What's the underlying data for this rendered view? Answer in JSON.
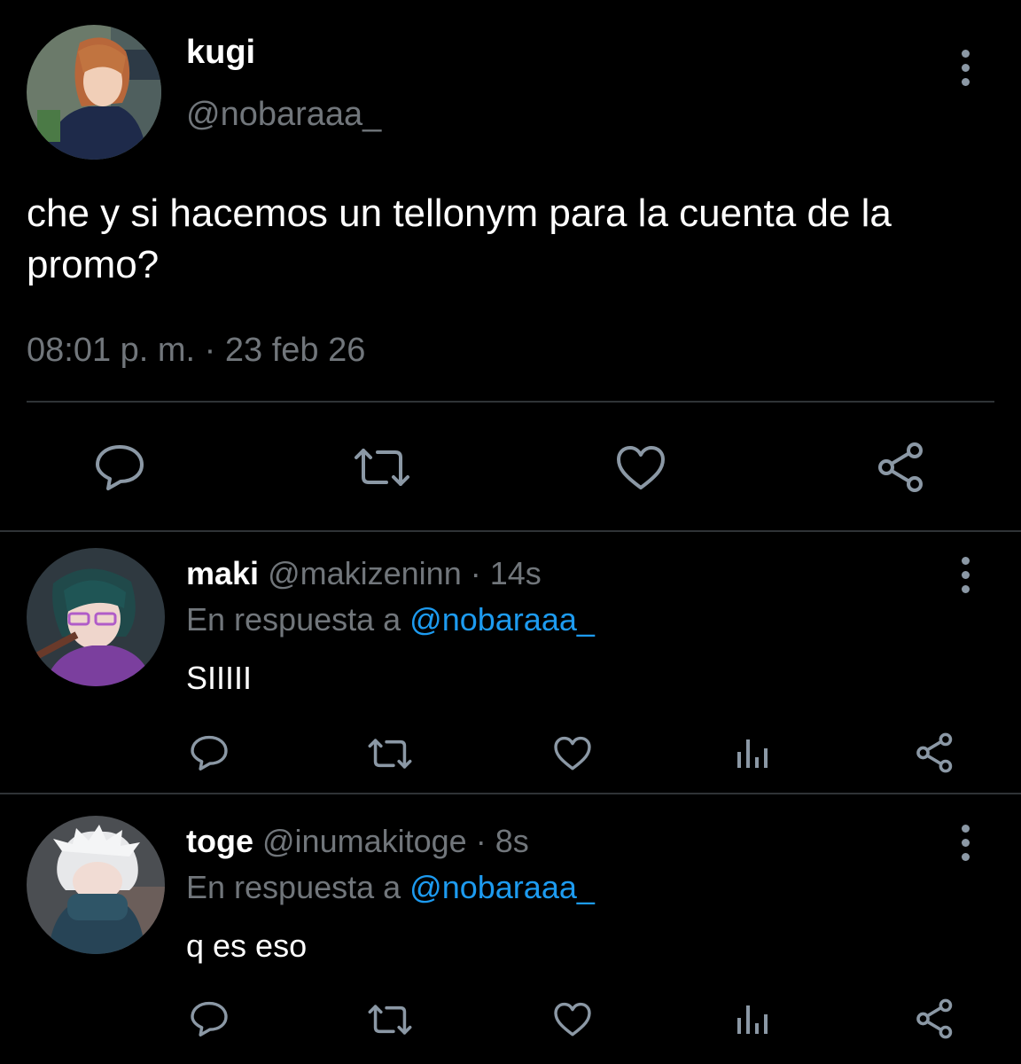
{
  "main_tweet": {
    "name": "kugi",
    "handle": "@nobaraaa_",
    "text": "che y si hacemos un tellonym para la cuenta de la promo?",
    "timestamp": "08:01 p. m. · 23 feb 26",
    "actions": [
      "reply-icon",
      "retweet-icon",
      "like-icon",
      "share-icon"
    ]
  },
  "replies": [
    {
      "name": "maki",
      "handle": "@makizeninn",
      "time": "· 14s",
      "reply_prefix": "En respuesta a",
      "mention": "@nobaraaa_",
      "text": "SIIIII",
      "actions": [
        "reply-icon",
        "retweet-icon",
        "like-icon",
        "views-icon",
        "share-icon"
      ]
    },
    {
      "name": "toge",
      "handle": "@inumakitoge",
      "time": "· 8s",
      "reply_prefix": "En respuesta a",
      "mention": "@nobaraaa_",
      "text": "q es eso",
      "actions": [
        "reply-icon",
        "retweet-icon",
        "like-icon",
        "views-icon",
        "share-icon"
      ]
    }
  ],
  "colors": {
    "background": "#000000",
    "text": "#ffffff",
    "secondary": "#71767b",
    "mention": "#1d9bf0",
    "divider": "#2f3336"
  }
}
